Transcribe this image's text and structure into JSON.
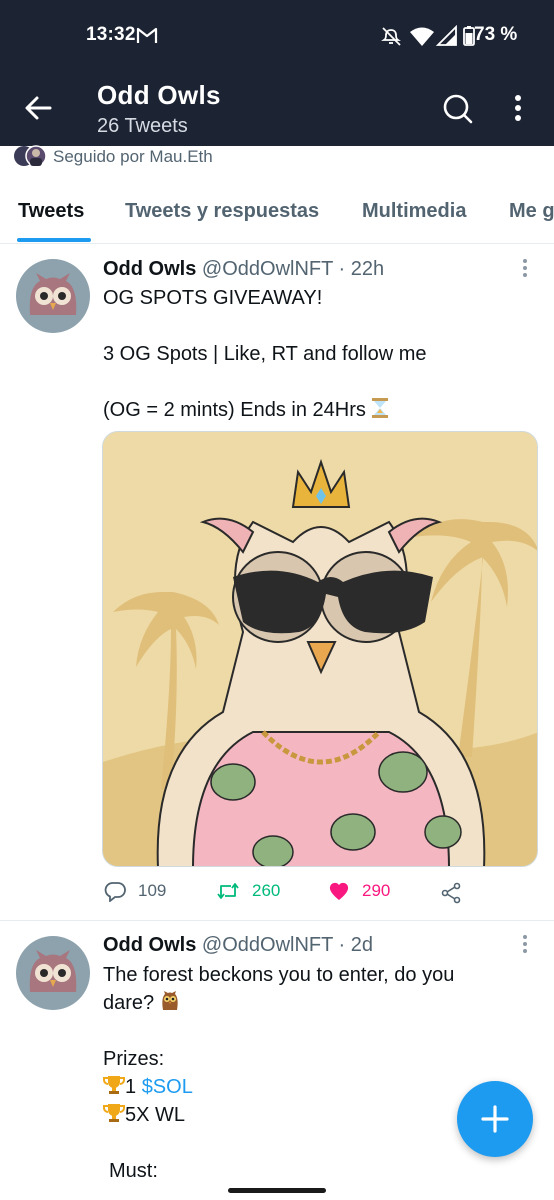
{
  "status_bar": {
    "time": "13:32",
    "battery": "73 %",
    "icons": [
      "gmail-icon",
      "do-not-disturb-icon",
      "wifi-icon",
      "signal-icon",
      "battery-icon"
    ]
  },
  "header": {
    "title": "Odd Owls",
    "subtitle": "26 Tweets"
  },
  "followed_by": {
    "text": "Seguido por Mau.Eth"
  },
  "tabs": [
    {
      "label": "Tweets",
      "active": true
    },
    {
      "label": "Tweets y respuestas"
    },
    {
      "label": "Multimedia"
    },
    {
      "label": "Me g"
    }
  ],
  "tweets": [
    {
      "name": "Odd Owls",
      "handle": "@OddOwlNFT · 22h",
      "lines": [
        "OG SPOTS GIVEAWAY!",
        "3 OG Spots | Like, RT and follow me",
        "(OG = 2 mints) Ends in 24Hrs"
      ],
      "stats": {
        "replies": "109",
        "retweets": "260",
        "likes": "290"
      }
    },
    {
      "name": "Odd Owls",
      "handle": "@OddOwlNFT · 2d",
      "lines": [
        "The forest beckons you to enter, do you",
        "dare?",
        "Prizes:",
        "1 ",
        "$SOL",
        "5X WL",
        "Must:"
      ]
    }
  ],
  "colors": {
    "header_bg": "#1c2333",
    "accent": "#1d9bf0",
    "retweet": "#00ba7c",
    "like": "#f91880"
  }
}
